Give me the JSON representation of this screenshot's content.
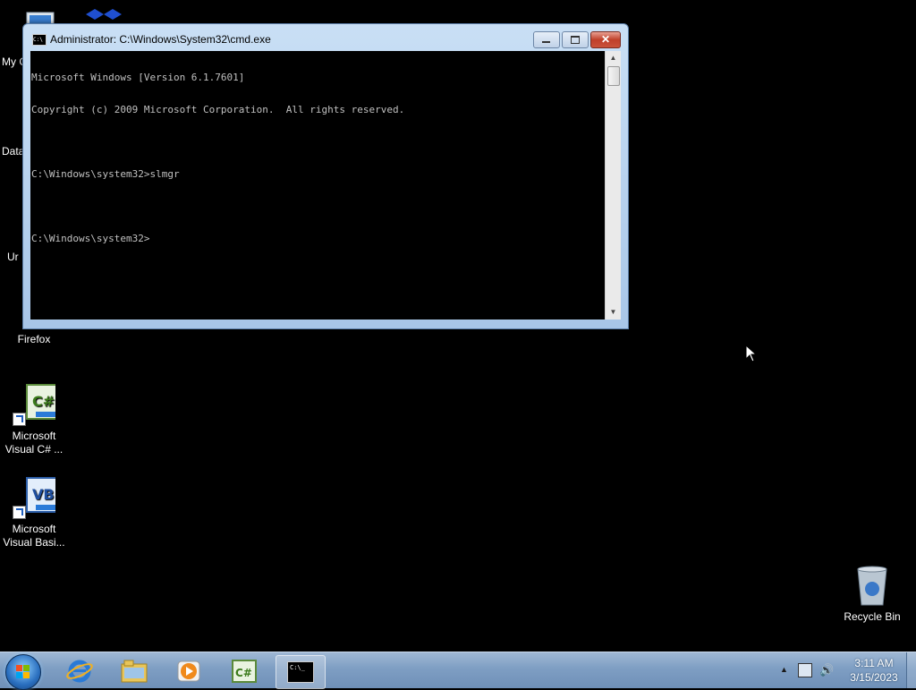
{
  "desktop": {
    "icons": [
      {
        "label": "My C",
        "icon": "computer-icon"
      },
      {
        "label": "Data",
        "icon": "database-icon"
      },
      {
        "label": "Ur",
        "icon": "program-icon"
      },
      {
        "label": "Firefox",
        "icon": "firefox-icon"
      },
      {
        "label": "Microsoft Visual C# ...",
        "line1": "Microsoft",
        "line2": "Visual C# ...",
        "icon": "visual-csharp-icon"
      },
      {
        "label": "Microsoft Visual Basi...",
        "line1": "Microsoft",
        "line2": "Visual Basi...",
        "icon": "visual-basic-icon"
      },
      {
        "label": "Recycle Bin",
        "icon": "recycle-bin-icon"
      }
    ]
  },
  "cmd_window": {
    "title": "Administrator: C:\\Windows\\System32\\cmd.exe",
    "close_glyph": "✕",
    "lines": [
      "Microsoft Windows [Version 6.1.7601]",
      "Copyright (c) 2009 Microsoft Corporation.  All rights reserved.",
      "",
      "C:\\Windows\\system32>slmgr",
      "",
      "C:\\Windows\\system32>"
    ],
    "scroll_up_glyph": "▲",
    "scroll_down_glyph": "▼"
  },
  "taskbar": {
    "pinned": [
      {
        "name": "internet-explorer-icon"
      },
      {
        "name": "windows-explorer-icon"
      },
      {
        "name": "media-player-icon"
      },
      {
        "name": "visual-csharp-taskbar-icon"
      },
      {
        "name": "cmd-taskbar-icon",
        "active": true
      }
    ],
    "cmd_taskbar_text": "C:\\_",
    "tray": {
      "show_hidden_glyph": "▲",
      "volume_glyph": "🔊"
    },
    "clock": {
      "time": "3:11 AM",
      "date": "3/15/2023"
    }
  },
  "colors": {
    "desktop_bg": "#000000",
    "console_bg": "#000000",
    "console_fg": "#c0c0c0",
    "close_button": "#c0402a"
  }
}
